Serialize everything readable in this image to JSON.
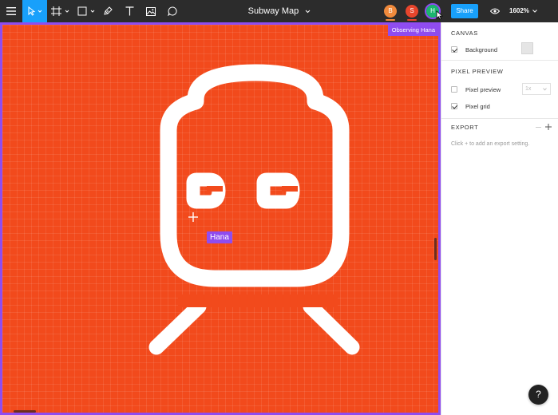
{
  "toolbar": {
    "file_title": "Subway Map",
    "share_label": "Share",
    "zoom_level": "1602%",
    "tools": [
      "menu-icon",
      "move-tool-icon",
      "frame-tool-icon",
      "shape-tool-icon",
      "pen-tool-icon",
      "text-tool-icon",
      "image-icon",
      "comment-icon"
    ],
    "active_tool": "move-tool-icon",
    "collaborators": [
      {
        "initial": "B",
        "color": "#f08a3c"
      },
      {
        "initial": "S",
        "color": "#e8452c"
      },
      {
        "initial": "H",
        "color": "#1bb56e"
      }
    ],
    "accent_color": "#18a0fb"
  },
  "canvas": {
    "observing_label": "Observing Hana",
    "cursor_name": "Hana",
    "background_color": "#f24a1c",
    "observer_color": "#8f4cf0"
  },
  "panel": {
    "canvas_section": "CANVAS",
    "background_label": "Background",
    "pixel_preview_section": "PIXEL PREVIEW",
    "pixel_preview_label": "Pixel preview",
    "pixel_preview_scale": "1x",
    "pixel_grid_label": "Pixel grid",
    "export_section": "EXPORT",
    "export_hint": "Click + to add an export setting."
  },
  "help_label": "?"
}
